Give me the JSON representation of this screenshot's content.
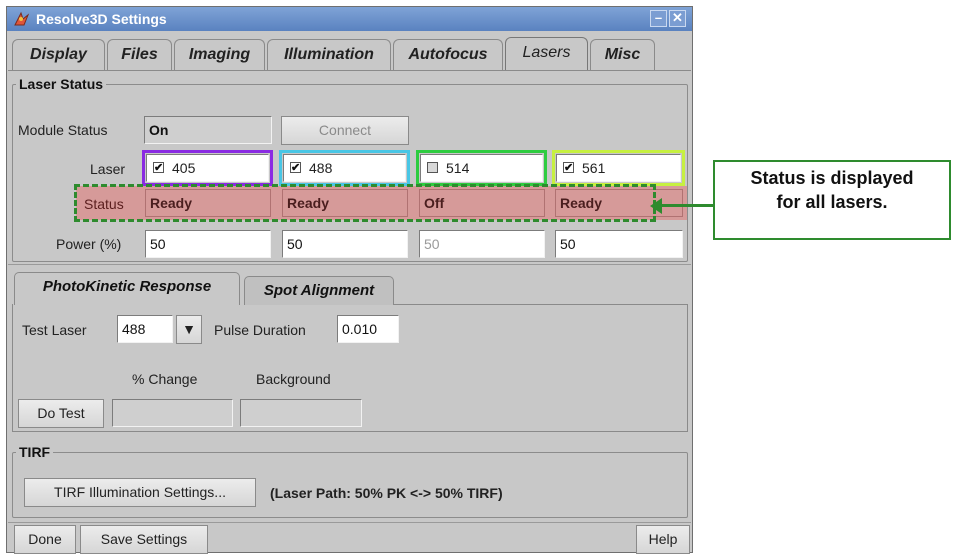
{
  "window": {
    "title": "Resolve3D Settings"
  },
  "tabs": [
    "Display",
    "Files",
    "Imaging",
    "Illumination",
    "Autofocus",
    "Lasers",
    "Misc"
  ],
  "laser_status": {
    "legend": "Laser Status",
    "module_status_label": "Module Status",
    "module_status_value": "On",
    "connect_button": "Connect",
    "laser_label": "Laser",
    "lasers": [
      {
        "name": "405",
        "checked": true,
        "check_glyph": "✔",
        "color": "#8a2be2"
      },
      {
        "name": "488",
        "checked": true,
        "check_glyph": "✔",
        "color": "#49c6e5"
      },
      {
        "name": "514",
        "checked": false,
        "check_glyph": "",
        "color": "#2ecc40"
      },
      {
        "name": "561",
        "checked": true,
        "check_glyph": "✔",
        "color": "#c6f040"
      }
    ],
    "status_label": "Status",
    "statuses": [
      "Ready",
      "Ready",
      "Off",
      "Ready"
    ],
    "power_label": "Power (%)",
    "powers": [
      "50",
      "50",
      "50",
      "50"
    ]
  },
  "subtabs": [
    "PhotoKinetic Response",
    "Spot Alignment"
  ],
  "photokinetic": {
    "test_laser_label": "Test Laser",
    "test_laser_value": "488",
    "pulse_duration_label": "Pulse Duration",
    "pulse_duration_value": "0.010",
    "change_label": "% Change",
    "background_label": "Background",
    "do_test_button": "Do Test",
    "change_value": "",
    "background_value": ""
  },
  "tirf": {
    "legend": "TIRF",
    "settings_button": "TIRF Illumination Settings...",
    "laser_path_text": "(Laser Path:  50% PK <-> 50% TIRF)"
  },
  "footer": {
    "done_button": "Done",
    "save_button": "Save Settings",
    "help_button": "Help"
  },
  "callout": {
    "line1": "Status is displayed",
    "line2": "for all lasers."
  },
  "colors": {
    "status_fill": "#d69a99",
    "highlight_dash": "#2e8b2e",
    "titlebar": "#6a8fcb"
  }
}
